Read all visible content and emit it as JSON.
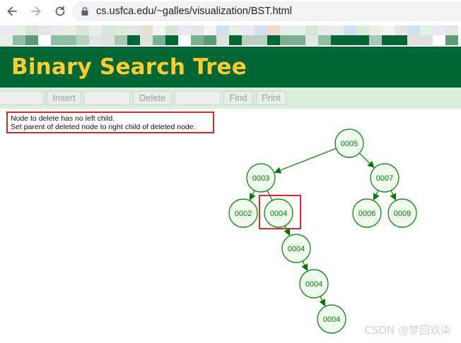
{
  "browser": {
    "url_host": "cs.usfca.edu",
    "url_path": "/~galles/visualization/BST.html",
    "back_icon": "arrow-left-icon",
    "forward_icon": "arrow-right-icon",
    "reload_icon": "reload-icon",
    "lock_icon": "lock-icon"
  },
  "banner": {
    "title": "Binary Search Tree"
  },
  "controls": {
    "insert_input_value": "",
    "insert_label": "Insert",
    "delete_input_value": "",
    "delete_label": "Delete",
    "find_input_value": "",
    "find_label": "Find",
    "print_label": "Print"
  },
  "message": {
    "line1": "Node to delete has no left child.",
    "line2": "Set parent of deleted node to right child of deleted node."
  },
  "tree": {
    "nodes": [
      {
        "id": "n5",
        "label": "0005"
      },
      {
        "id": "n3",
        "label": "0003"
      },
      {
        "id": "n7",
        "label": "0007"
      },
      {
        "id": "n2",
        "label": "0002"
      },
      {
        "id": "n4a",
        "label": "0004",
        "highlighted": true
      },
      {
        "id": "n6",
        "label": "0006"
      },
      {
        "id": "n9",
        "label": "0009"
      },
      {
        "id": "n4b",
        "label": "0004"
      },
      {
        "id": "n4c",
        "label": "0004"
      },
      {
        "id": "n4d",
        "label": "0004"
      }
    ],
    "edges": [
      [
        "n5",
        "n3"
      ],
      [
        "n5",
        "n7"
      ],
      [
        "n3",
        "n2"
      ],
      [
        "n3",
        "n4b"
      ],
      [
        "n7",
        "n6"
      ],
      [
        "n7",
        "n9"
      ],
      [
        "n4b",
        "n4c"
      ],
      [
        "n4c",
        "n4d"
      ]
    ],
    "colors": {
      "node_fill": "#f0fbef",
      "node_stroke": "#007a00",
      "label": "#007a00",
      "edge": "#007a00",
      "highlight": "#d22a2a"
    }
  },
  "watermark": "CSDN @梦回玖柒",
  "colors": {
    "banner_bg": "#006633",
    "banner_text": "#ffcc33",
    "controls_bg": "#d9efdb"
  }
}
